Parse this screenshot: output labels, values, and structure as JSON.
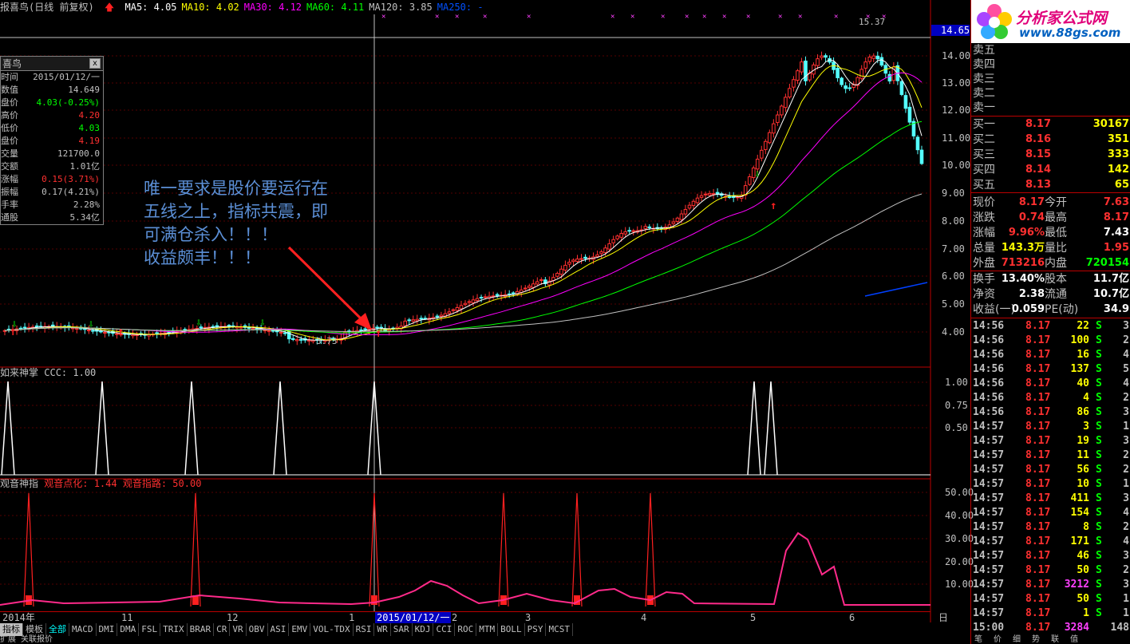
{
  "title_bar": {
    "title": "报喜鸟(日线 前复权)"
  },
  "ma_legend": [
    {
      "label": "MA5: 4.05",
      "color": "#ffffff"
    },
    {
      "label": "MA10: 4.02",
      "color": "#ffff00"
    },
    {
      "label": "MA30: 4.12",
      "color": "#ff00ff"
    },
    {
      "label": "MA60: 4.11",
      "color": "#00ff00"
    },
    {
      "label": "MA120: 3.85",
      "color": "#c0c0c0"
    },
    {
      "label": "MA250: -",
      "color": "#0050ff"
    }
  ],
  "info_panel": {
    "title": "喜鸟",
    "close": "x",
    "rows": [
      {
        "label": "时间",
        "value": "2015/01/12/一",
        "color": "#c0c0c0"
      },
      {
        "label": "数值",
        "value": "14.649",
        "color": "#c0c0c0"
      },
      {
        "label": "盘价",
        "value": "4.03(-0.25%)",
        "color": "#00ff00"
      },
      {
        "label": "高价",
        "value": "4.20",
        "color": "#ff3030"
      },
      {
        "label": "低价",
        "value": "4.03",
        "color": "#00ff00"
      },
      {
        "label": "盘价",
        "value": "4.19",
        "color": "#ff3030"
      },
      {
        "label": "交量",
        "value": "121700.0",
        "color": "#c0c0c0"
      },
      {
        "label": "交额",
        "value": "1.01亿",
        "color": "#c0c0c0"
      },
      {
        "label": "涨幅",
        "value": "0.15(3.71%)",
        "color": "#ff3030"
      },
      {
        "label": "振幅",
        "value": "0.17(4.21%)",
        "color": "#c0c0c0"
      },
      {
        "label": "手率",
        "value": "2.28%",
        "color": "#c0c0c0"
      },
      {
        "label": "通股",
        "value": "5.34亿",
        "color": "#c0c0c0"
      }
    ]
  },
  "annotation": "唯一要求是股价要运行在\n五线之上，指标共震，即\n可满仓杀入！！！\n收益颇丰！！！",
  "price_axis": [
    "14.00",
    "13.00",
    "12.00",
    "11.00",
    "10.00",
    "9.00",
    "8.00",
    "7.00",
    "6.00",
    "5.00",
    "4.00"
  ],
  "price_marker": "14.65",
  "peak_label": "15.37",
  "low_label": "3.73",
  "indicator1": {
    "name": "如来神掌",
    "param": "CCC: 1.00",
    "axis": [
      "1.00",
      "0.75",
      "0.50"
    ]
  },
  "indicator2": {
    "name": "观音神指",
    "p1": "观音点化: 1.44",
    "p2": "观音指路: 50.00",
    "axis": [
      "50.00",
      "40.00",
      "30.00",
      "20.00",
      "10.00"
    ]
  },
  "time_axis": [
    "2014年",
    "11",
    "12",
    "1",
    "2015/01/12/一",
    "2",
    "3",
    "4",
    "5",
    "6"
  ],
  "period": "日线",
  "tabs": [
    "指标",
    "模板",
    "全部",
    "MACD",
    "DMI",
    "DMA",
    "FSL",
    "TRIX",
    "BRAR",
    "CR",
    "VR",
    "OBV",
    "ASI",
    "EMV",
    "VOL-TDX",
    "RSI",
    "WR",
    "SAR",
    "KDJ",
    "CCI",
    "ROC",
    "MTM",
    "BOLL",
    "PSY",
    "MCST"
  ],
  "status": "扩展  关联报价",
  "logo": {
    "cn": "分析家公式网",
    "url": "www.88gs.com"
  },
  "sell_levels": [
    "卖五",
    "卖四",
    "卖三",
    "卖二",
    "卖一"
  ],
  "buy_levels": [
    {
      "label": "买一",
      "price": "8.17",
      "vol": "30167"
    },
    {
      "label": "买二",
      "price": "8.16",
      "vol": "351"
    },
    {
      "label": "买三",
      "price": "8.15",
      "vol": "333"
    },
    {
      "label": "买四",
      "price": "8.14",
      "vol": "142"
    },
    {
      "label": "买五",
      "price": "8.13",
      "vol": "65"
    }
  ],
  "quote_rows": [
    {
      "l1": "现价",
      "v1": "8.17",
      "c1": "#ff3030",
      "l2": "今开",
      "v2": "7.63",
      "c2": "#ff3030"
    },
    {
      "l1": "涨跌",
      "v1": "0.74",
      "c1": "#ff3030",
      "l2": "最高",
      "v2": "8.17",
      "c2": "#ff3030"
    },
    {
      "l1": "涨幅",
      "v1": "9.96%",
      "c1": "#ff3030",
      "l2": "最低",
      "v2": "7.43",
      "c2": "#ffffff"
    },
    {
      "l1": "总量",
      "v1": "143.3万",
      "c1": "#ffff00",
      "l2": "量比",
      "v2": "1.95",
      "c2": "#ff3030"
    },
    {
      "l1": "外盘",
      "v1": "713216",
      "c1": "#ff3030",
      "l2": "内盘",
      "v2": "720154",
      "c2": "#00ff00"
    },
    {
      "l1": "换手",
      "v1": "13.40%",
      "c1": "#ffffff",
      "l2": "股本",
      "v2": "11.7亿",
      "c2": "#ffffff"
    },
    {
      "l1": "净资",
      "v1": "2.38",
      "c1": "#ffffff",
      "l2": "流通",
      "v2": "10.7亿",
      "c2": "#ffffff"
    },
    {
      "l1": "收益(一)",
      "v1": "0.059",
      "c1": "#ffffff",
      "l2": "PE(动)",
      "v2": "34.9",
      "c2": "#ffffff"
    }
  ],
  "trades": [
    {
      "t": "14:56",
      "p": "8.17",
      "v": "22",
      "d": "S",
      "n": "3"
    },
    {
      "t": "14:56",
      "p": "8.17",
      "v": "100",
      "d": "S",
      "n": "2"
    },
    {
      "t": "14:56",
      "p": "8.17",
      "v": "16",
      "d": "S",
      "n": "4"
    },
    {
      "t": "14:56",
      "p": "8.17",
      "v": "137",
      "d": "S",
      "n": "5"
    },
    {
      "t": "14:56",
      "p": "8.17",
      "v": "40",
      "d": "S",
      "n": "4"
    },
    {
      "t": "14:56",
      "p": "8.17",
      "v": "4",
      "d": "S",
      "n": "2"
    },
    {
      "t": "14:56",
      "p": "8.17",
      "v": "86",
      "d": "S",
      "n": "3"
    },
    {
      "t": "14:57",
      "p": "8.17",
      "v": "3",
      "d": "S",
      "n": "1"
    },
    {
      "t": "14:57",
      "p": "8.17",
      "v": "19",
      "d": "S",
      "n": "3"
    },
    {
      "t": "14:57",
      "p": "8.17",
      "v": "11",
      "d": "S",
      "n": "2"
    },
    {
      "t": "14:57",
      "p": "8.17",
      "v": "56",
      "d": "S",
      "n": "2"
    },
    {
      "t": "14:57",
      "p": "8.17",
      "v": "10",
      "d": "S",
      "n": "1"
    },
    {
      "t": "14:57",
      "p": "8.17",
      "v": "411",
      "d": "S",
      "n": "3"
    },
    {
      "t": "14:57",
      "p": "8.17",
      "v": "154",
      "d": "S",
      "n": "4"
    },
    {
      "t": "14:57",
      "p": "8.17",
      "v": "8",
      "d": "S",
      "n": "2"
    },
    {
      "t": "14:57",
      "p": "8.17",
      "v": "171",
      "d": "S",
      "n": "4"
    },
    {
      "t": "14:57",
      "p": "8.17",
      "v": "46",
      "d": "S",
      "n": "3"
    },
    {
      "t": "14:57",
      "p": "8.17",
      "v": "50",
      "d": "S",
      "n": "2"
    },
    {
      "t": "14:57",
      "p": "8.17",
      "v": "3212",
      "d": "S",
      "n": "3"
    },
    {
      "t": "14:57",
      "p": "8.17",
      "v": "50",
      "d": "S",
      "n": "1"
    },
    {
      "t": "14:57",
      "p": "8.17",
      "v": "1",
      "d": "S",
      "n": "1"
    },
    {
      "t": "15:00",
      "p": "8.17",
      "v": "3284",
      "d": "",
      "n": "148"
    }
  ],
  "bottom_right_tabs": [
    "笔",
    "价",
    "细",
    "势",
    "联",
    "值"
  ]
}
